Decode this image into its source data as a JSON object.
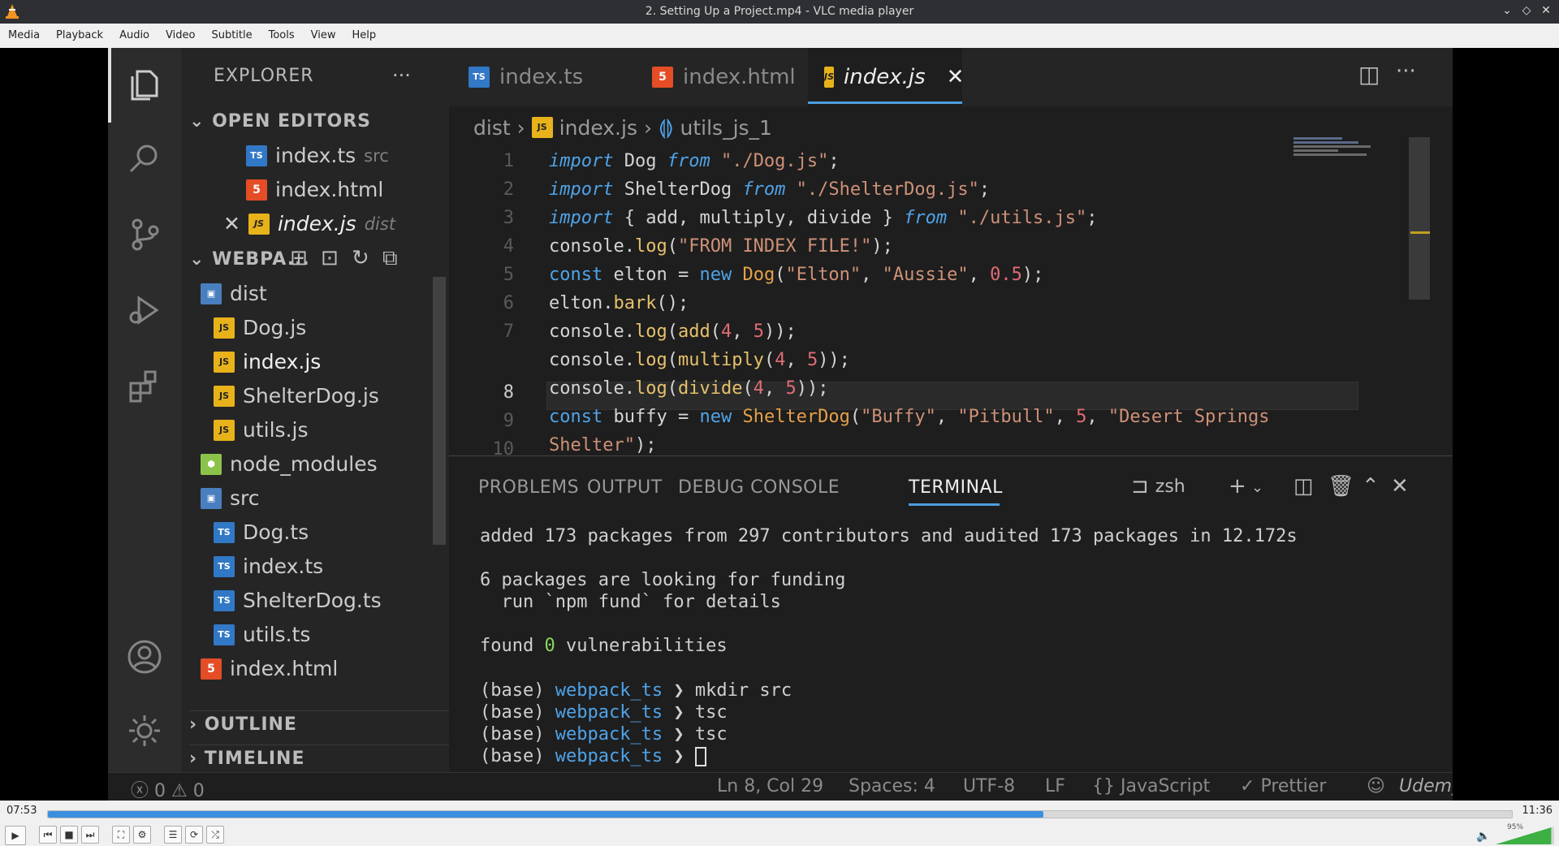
{
  "window": {
    "title": "2. Setting Up a Project.mp4 - VLC media player",
    "buttons": [
      "minimize-icon",
      "restore-icon",
      "close-icon"
    ]
  },
  "menu": [
    "Media",
    "Playback",
    "Audio",
    "Video",
    "Subtitle",
    "Tools",
    "View",
    "Help"
  ],
  "explorer": {
    "title": "EXPLORER",
    "open_editors_label": "OPEN EDITORS",
    "open_editors": [
      {
        "name": "index.ts",
        "hint": "src"
      },
      {
        "name": "index.html",
        "hint": ""
      },
      {
        "name": "index.js",
        "hint": "dist"
      }
    ],
    "workspace_label": "WEBPA...",
    "tree": {
      "dist": "dist",
      "dist_files": [
        "Dog.js",
        "index.js",
        "ShelterDog.js",
        "utils.js"
      ],
      "node_modules": "node_modules",
      "src": "src",
      "src_files": [
        "Dog.ts",
        "index.ts",
        "ShelterDog.ts",
        "utils.ts"
      ],
      "index_html": "index.html"
    },
    "outline_label": "OUTLINE",
    "timeline_label": "TIMELINE"
  },
  "editor": {
    "tabs": [
      "index.ts",
      "index.html",
      "index.js"
    ],
    "active_tab": "index.js",
    "breadcrumb": [
      "dist",
      "index.js",
      "utils_js_1"
    ],
    "current_line": 8,
    "line_numbers": [
      "1",
      "2",
      "3",
      "4",
      "5",
      "6",
      "7",
      "8",
      "9",
      "10"
    ]
  },
  "panel": {
    "tabs": [
      "PROBLEMS",
      "OUTPUT",
      "DEBUG CONSOLE",
      "TERMINAL"
    ],
    "active_tab": "TERMINAL",
    "shell": "zsh",
    "terminal_lines": [
      "added 173 packages from 297 contributors and audited 173 packages in 12.172s",
      "6 packages are looking for funding",
      "  run `npm fund` for details",
      "found 0 vulnerabilities"
    ],
    "prompts": [
      {
        "prefix": "(base) ",
        "dir": "webpack_ts",
        "arrow": " ❯ ",
        "cmd": "mkdir src"
      },
      {
        "prefix": "(base) ",
        "dir": "webpack_ts",
        "arrow": " ❯ ",
        "cmd": "tsc"
      },
      {
        "prefix": "(base) ",
        "dir": "webpack_ts",
        "arrow": " ❯ ",
        "cmd": "tsc"
      },
      {
        "prefix": "(base) ",
        "dir": "webpack_ts",
        "arrow": " ❯ ",
        "cmd": ""
      }
    ]
  },
  "status": {
    "errors": "0",
    "warnings": "0",
    "position": "Ln 8, Col 29",
    "spaces": "Spaces: 4",
    "encoding": "UTF-8",
    "eol": "LF",
    "language": "JavaScript",
    "formatter": "Prettier",
    "watermark": "Udemy"
  },
  "player": {
    "time_current": "07:53",
    "time_total": "11:36",
    "progress": 0.68,
    "volume_label": "95%",
    "volume": 0.95
  }
}
